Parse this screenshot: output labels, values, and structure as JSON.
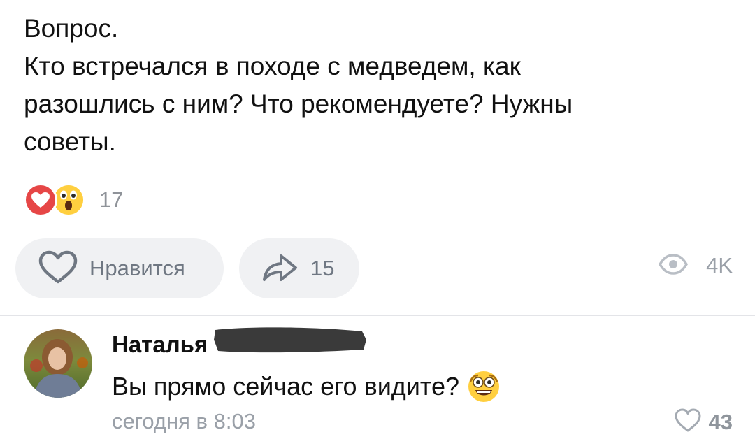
{
  "post": {
    "lines": [
      "Вопрос.",
      "Кто встречался в походе с медведем, как",
      "разошлись с ним? Что рекомендуете? Нужны",
      "советы."
    ]
  },
  "reactions": {
    "icons": [
      "heart-reaction-icon",
      "shocked-face-reaction-icon"
    ],
    "count": "17"
  },
  "actions": {
    "like_label": "Нравится",
    "share_count": "15",
    "views_count": "4K"
  },
  "comment": {
    "author": "Наталья",
    "text": "Вы прямо сейчас его видите?",
    "time": "сегодня в 8:03",
    "likes": "43"
  },
  "colors": {
    "reaction_heart": "#e64646",
    "reaction_emoji": "#ffcf3f",
    "button_bg": "#f0f1f3",
    "muted_text": "#9aa0a8"
  }
}
